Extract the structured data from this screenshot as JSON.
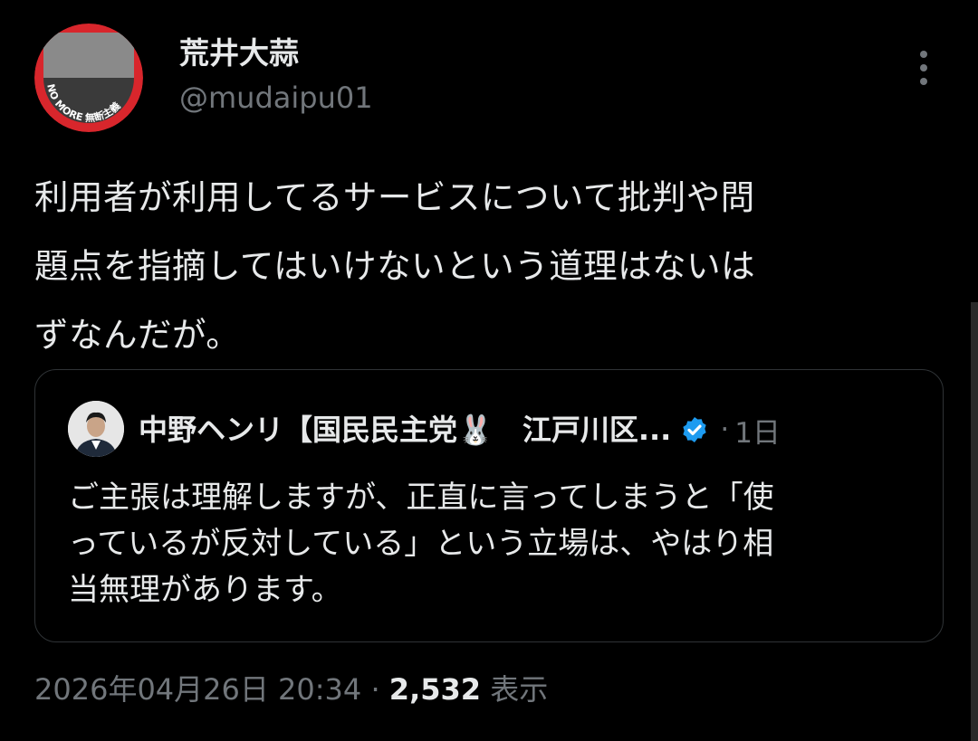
{
  "tweet": {
    "author": {
      "display_name": "荒井大蒜",
      "handle": "@mudaipu01",
      "avatar_text": "NO MORE 無断主義"
    },
    "text": "利用者が利用してるサービスについて批判や問\n題点を指摘してはいけないという道理はないは\nずなんだが。",
    "quote": {
      "author_name": "中野ヘンリ【国民民主党🐰　江戸川区...",
      "verified": true,
      "time": "1日",
      "separator": "·",
      "text": "ご主張は理解しますが、正直に言ってしまうと「使\nっているが反対している」という立場は、やはり相\n当無理があります。"
    },
    "timestamp": "2026年04月26日 20:34",
    "meta_separator": "·",
    "views_count": "2,532",
    "views_label": "表示"
  },
  "colors": {
    "background": "#000000",
    "text_primary": "#e7e9ea",
    "text_secondary": "#71767b",
    "border": "#2f3336",
    "verified_blue": "#1d9bf0",
    "avatar_ring": "#d8262c"
  },
  "icons": {
    "more": "more-vertical-icon",
    "verified": "verified-badge-icon"
  }
}
